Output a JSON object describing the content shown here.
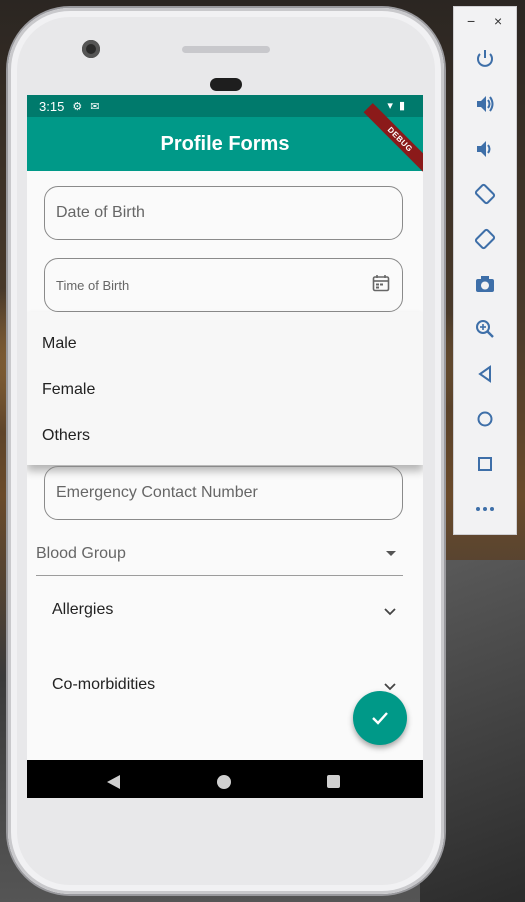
{
  "app": {
    "title": "Profile Forms",
    "debug_banner": "DEBUG",
    "accent_color": "#009988"
  },
  "statusbar": {
    "time": "3:15",
    "icons": [
      "settings-icon",
      "mail-icon",
      "wifi-icon",
      "battery-icon"
    ]
  },
  "form": {
    "date_of_birth_placeholder": "Date of Birth",
    "time_of_birth_placeholder": "Time of Birth",
    "emergency_contact_placeholder": "Emergency Contact Number",
    "blood_group_label": "Blood Group"
  },
  "gender_menu": {
    "options": [
      "Male",
      "Female",
      "Others"
    ]
  },
  "expanders": {
    "allergies": "Allergies",
    "comorbidities": "Co-morbidities"
  },
  "emulator_panel": {
    "minimize": "−",
    "close": "×",
    "tools": [
      "power-icon",
      "volume-up-icon",
      "volume-down-icon",
      "rotate-left-icon",
      "rotate-right-icon",
      "camera-icon",
      "zoom-icon",
      "back-icon",
      "home-icon",
      "overview-icon",
      "more-icon"
    ]
  }
}
